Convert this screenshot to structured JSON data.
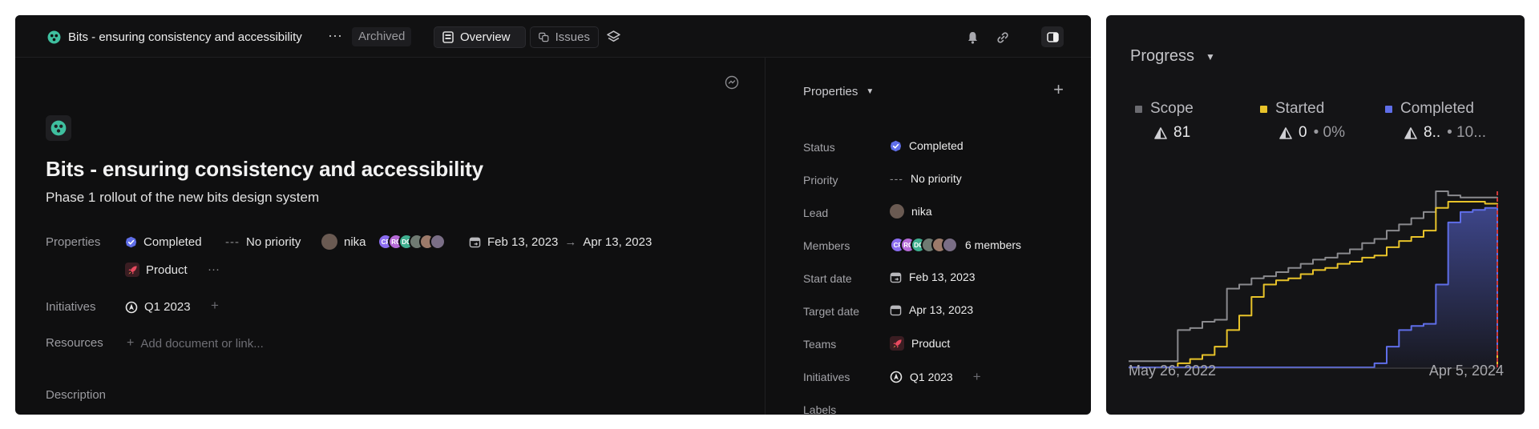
{
  "topbar": {
    "project_title": "Bits - ensuring consistency and accessibility",
    "more_label": "···",
    "archived_label": "Archived",
    "tabs": [
      {
        "label": "Overview",
        "active": true
      },
      {
        "label": "Issues",
        "active": false
      }
    ]
  },
  "project": {
    "title": "Bits - ensuring consistency and accessibility",
    "subtitle": "Phase 1 rollout of the new bits design system",
    "properties_label": "Properties",
    "status": "Completed",
    "priority": "No priority",
    "lead": "nika",
    "start_date": "Feb 13, 2023",
    "arrow": "→",
    "target_date": "Apr 13, 2023",
    "team": "Product",
    "initiatives_label": "Initiatives",
    "initiative": "Q1 2023",
    "resources_label": "Resources",
    "add_resource_placeholder": "Add document or link...",
    "description_label": "Description",
    "member_avatars": [
      {
        "initials": "CF",
        "color": "#8a6cf0"
      },
      {
        "initials": "RC",
        "color": "#b56ad6"
      },
      {
        "initials": "DC",
        "color": "#3fae8f"
      },
      {
        "initials": "",
        "color": "#6f7a72"
      },
      {
        "initials": "",
        "color": "#9c7a6a"
      },
      {
        "initials": "",
        "color": "#7a6e86"
      }
    ]
  },
  "properties_panel": {
    "header": "Properties",
    "rows": [
      {
        "label": "Status",
        "value": "Completed"
      },
      {
        "label": "Priority",
        "value": "No priority"
      },
      {
        "label": "Lead",
        "value": "nika"
      },
      {
        "label": "Members",
        "value": "6 members"
      },
      {
        "label": "Start date",
        "value": "Feb 13, 2023"
      },
      {
        "label": "Target date",
        "value": "Apr 13, 2023"
      },
      {
        "label": "Teams",
        "value": "Product"
      },
      {
        "label": "Initiatives",
        "value": "Q1 2023"
      },
      {
        "label": "Labels",
        "value": ""
      }
    ]
  },
  "progress": {
    "title": "Progress",
    "legend": [
      {
        "name": "Scope",
        "value": "81",
        "percent": "",
        "color": "#6b6b70"
      },
      {
        "name": "Started",
        "value": "0",
        "percent": "• 0%",
        "color": "#e8c32a"
      },
      {
        "name": "Completed",
        "value": "8..",
        "percent": "• 10...",
        "color": "#5f6ee8"
      }
    ],
    "x_start_label": "May 26, 2022",
    "x_end_label": "Apr 5, 2024"
  },
  "colors": {
    "accent_completed": "#5f6ee8",
    "started": "#e8c32a",
    "scope": "#8a8a8e",
    "today_line": "#d03a3a",
    "project_icon": "#3fbf9f"
  },
  "chart_data": {
    "type": "line",
    "x_range": [
      "May 26, 2022",
      "Apr 5, 2024"
    ],
    "series": [
      {
        "name": "Scope",
        "values": [
          3,
          3,
          3,
          3,
          18,
          19,
          22,
          23,
          38,
          40,
          43,
          44,
          46,
          48,
          50,
          52,
          53,
          55,
          57,
          60,
          62,
          66,
          69,
          72,
          75,
          85,
          83,
          82,
          82,
          82,
          81
        ]
      },
      {
        "name": "Started",
        "values": [
          0,
          0,
          0,
          0,
          2,
          4,
          6,
          10,
          18,
          25,
          34,
          40,
          42,
          43,
          45,
          47,
          48,
          50,
          51,
          53,
          54,
          58,
          61,
          63,
          66,
          77,
          80,
          80,
          80,
          79,
          0
        ]
      },
      {
        "name": "Completed",
        "values": [
          0,
          0,
          0,
          0,
          0,
          0,
          0,
          0,
          0,
          0,
          0,
          0,
          0,
          0,
          0,
          0,
          0,
          0,
          0,
          0,
          2,
          10,
          18,
          20,
          21,
          40,
          70,
          75,
          76,
          77,
          8
        ]
      }
    ],
    "ylim": [
      0,
      85
    ]
  }
}
